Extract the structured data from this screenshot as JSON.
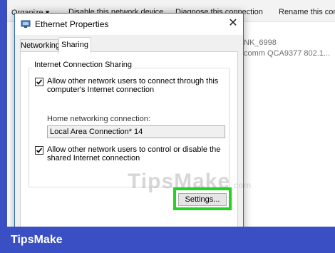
{
  "background_window": {
    "toolbar": {
      "organize": "Organize ▾",
      "disable": "Disable this network device",
      "diagnose": "Diagnose this connection",
      "rename": "Rename this con"
    },
    "adapter_name": "NK_6998",
    "adapter_desc": "comm QCA9377 802.1..."
  },
  "dialog": {
    "title": "Ethernet Properties",
    "close_glyph": "✕",
    "tabs": [
      "Networking",
      "Sharing"
    ],
    "active_tab": "Sharing",
    "group_label": "Internet Connection Sharing",
    "allow_connect": {
      "checked": true,
      "label": "Allow other network users to connect through this computer's Internet connection"
    },
    "home_connection_label": "Home networking connection:",
    "home_connection_value": "Local Area Connection* 14",
    "allow_control": {
      "checked": true,
      "label": "Allow other network users to control or disable the shared Internet connection"
    },
    "settings_button": "Settings..."
  },
  "watermark": {
    "text": "TipsMake",
    "suffix": ".com"
  },
  "brand": "TipsMake",
  "colors": {
    "background": "#3a4fc4",
    "highlight": "#22d322",
    "dialog_border": "#2b6fb5"
  }
}
